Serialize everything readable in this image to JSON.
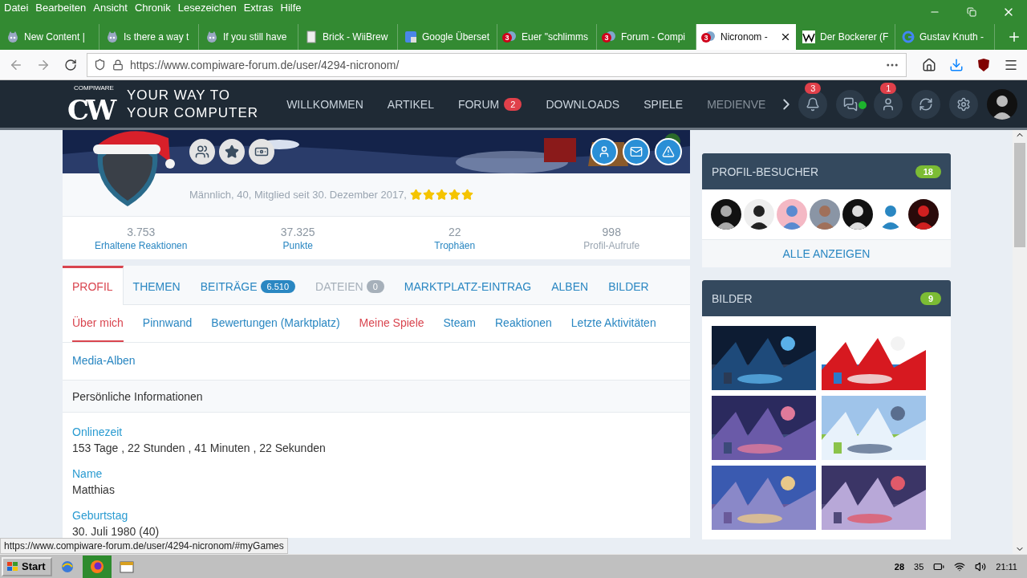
{
  "menu": [
    "Datei",
    "Bearbeiten",
    "Ansicht",
    "Chronik",
    "Lesezeichen",
    "Extras",
    "Hilfe"
  ],
  "browser_tabs": [
    {
      "title": "New Content |",
      "selected": false
    },
    {
      "title": "Is there a way t",
      "selected": false
    },
    {
      "title": "If you still have",
      "selected": false
    },
    {
      "title": "Brick - WiiBrew",
      "selected": false
    },
    {
      "title": "Google Überset",
      "selected": false
    },
    {
      "title": "Euer \"schlimms",
      "selected": false,
      "badge": "3"
    },
    {
      "title": "Forum - Compi",
      "selected": false,
      "badge": "3"
    },
    {
      "title": "Nicronom -",
      "selected": true,
      "badge": "3"
    },
    {
      "title": "Der Bockerer (F",
      "selected": false
    },
    {
      "title": "Gustav Knuth -",
      "selected": false
    }
  ],
  "address_bar": {
    "url": "https://www.compiware-forum.de/user/4294-nicronom/"
  },
  "site": {
    "logo": {
      "mark": "CW",
      "small": "COMPIWARE"
    },
    "tagline": [
      "YOUR WAY TO",
      "YOUR COMPUTER"
    ],
    "nav": [
      {
        "label": "WILLKOMMEN",
        "faded": false
      },
      {
        "label": "ARTIKEL",
        "faded": false
      },
      {
        "label": "FORUM",
        "badge": "2",
        "faded": false
      },
      {
        "label": "DOWNLOADS",
        "faded": false
      },
      {
        "label": "SPIELE",
        "faded": false
      },
      {
        "label": "MEDIENVE",
        "faded": true
      }
    ],
    "icons": [
      {
        "kind": "bell",
        "badge": "3"
      },
      {
        "kind": "chat",
        "online": true
      },
      {
        "kind": "user",
        "badge": "1"
      },
      {
        "kind": "refresh"
      },
      {
        "kind": "settings"
      },
      {
        "kind": "avatar"
      }
    ]
  },
  "profile": {
    "badges": [
      {
        "kind": "group"
      },
      {
        "kind": "star"
      },
      {
        "kind": "money"
      }
    ],
    "actions": [
      {
        "kind": "user"
      },
      {
        "kind": "mail"
      },
      {
        "kind": "warning"
      }
    ],
    "info": "Männlich, 40, Mitglied seit 30. Dezember 2017,",
    "stars": 5,
    "stats": [
      {
        "value": "3.753",
        "label": "Erhaltene Reaktionen",
        "link": true
      },
      {
        "value": "37.325",
        "label": "Punkte",
        "link": true
      },
      {
        "value": "22",
        "label": "Trophäen",
        "link": true
      },
      {
        "value": "998",
        "label": "Profil-Aufrufe",
        "link": false
      }
    ]
  },
  "profile_tabs": [
    {
      "label": "PROFIL",
      "selected": true,
      "disabled": false
    },
    {
      "label": "THEMEN",
      "selected": false,
      "disabled": false
    },
    {
      "label": "BEITRÄGE",
      "count": "6.510",
      "selected": false,
      "disabled": false
    },
    {
      "label": "DATEIEN",
      "count": "0",
      "selected": false,
      "disabled": true
    },
    {
      "label": "MARKTPLATZ-EINTRAG",
      "selected": false,
      "disabled": false
    },
    {
      "label": "ALBEN",
      "selected": false,
      "disabled": false
    },
    {
      "label": "BILDER",
      "selected": false,
      "disabled": false
    }
  ],
  "sub_tabs": [
    {
      "label": "Über mich",
      "selected": true,
      "hovered": false
    },
    {
      "label": "Pinnwand",
      "selected": false,
      "hovered": false
    },
    {
      "label": "Bewertungen (Marktplatz)",
      "selected": false,
      "hovered": false
    },
    {
      "label": "Meine Spiele",
      "selected": false,
      "hovered": true
    },
    {
      "label": "Steam",
      "selected": false,
      "hovered": false
    },
    {
      "label": "Reaktionen",
      "selected": false,
      "hovered": false
    },
    {
      "label": "Letzte Aktivitäten",
      "selected": false,
      "hovered": false
    },
    {
      "label": "Media-Alben",
      "selected": false,
      "hovered": false
    }
  ],
  "section_title": "Persönliche Informationen",
  "fields": [
    {
      "label": "Onlinezeit",
      "value": "153 Tage , 22 Stunden , 41 Minuten , 22 Sekunden"
    },
    {
      "label": "Name",
      "value": "Matthias"
    },
    {
      "label": "Geburtstag",
      "value": "30. Juli 1980 (40)"
    }
  ],
  "visitors": {
    "title": "PROFIL-BESUCHER",
    "count": "18",
    "link": "ALLE ANZEIGEN"
  },
  "images": {
    "title": "BILDER",
    "count": "9"
  },
  "status_url": "https://www.compiware-forum.de/user/4294-nicronom/#myGames",
  "taskbar": {
    "start": "Start",
    "tray": [
      "28",
      "35"
    ],
    "clock": "21:11"
  }
}
